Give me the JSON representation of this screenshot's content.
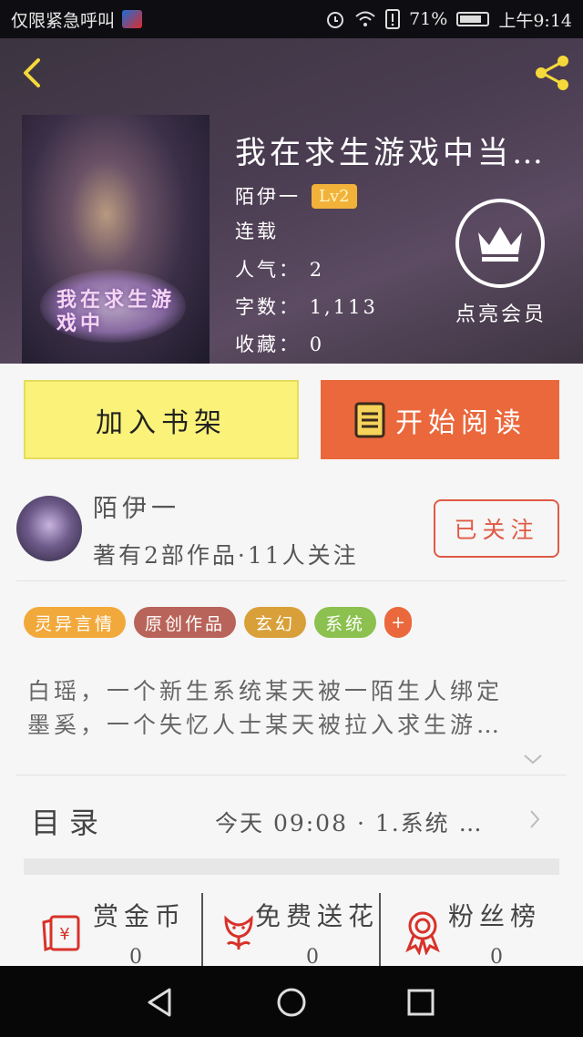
{
  "status_bar": {
    "carrier": "仅限紧急呼叫",
    "battery": "71%",
    "time": "上午9:14"
  },
  "book": {
    "title": "我在求生游戏中当…",
    "author": "陌伊一",
    "level": "Lv2",
    "status": "连载",
    "popularity_label": "人气：",
    "popularity": "2",
    "word_count_label": "字数：",
    "word_count": "1,113",
    "favorites_label": "收藏：",
    "favorites": "0",
    "cover_text": "我在求生游戏中"
  },
  "vip": {
    "label": "点亮会员"
  },
  "actions": {
    "add_to_shelf": "加入书架",
    "start_reading": "开始阅读"
  },
  "author_card": {
    "name": "陌伊一",
    "stats": "著有2部作品·11人关注",
    "follow_label": "已关注"
  },
  "tags": [
    {
      "label": "灵异言情",
      "color": "#f2a93b"
    },
    {
      "label": "原创作品",
      "color": "#b9645a"
    },
    {
      "label": "玄幻",
      "color": "#d9a03a"
    },
    {
      "label": "系统",
      "color": "#8cc04f"
    },
    {
      "label": "+",
      "color": "#ea683c"
    }
  ],
  "synopsis": {
    "line1": "白瑶，一个新生系统某天被一陌生人绑定",
    "line2": "墨奚，一个失忆人士某天被拉入求生游…"
  },
  "catalog": {
    "label": "目录",
    "latest": "今天 09:08 · 1.系统 …"
  },
  "stats": [
    {
      "label": "赏金币",
      "value": "0",
      "icon": "red-envelope-icon"
    },
    {
      "label": "免费送花",
      "value": "0",
      "icon": "flower-icon"
    },
    {
      "label": "粉丝榜",
      "value": "0",
      "icon": "medal-icon"
    }
  ],
  "colors": {
    "accent_orange": "#ea683c",
    "shelf_yellow": "#fbf27a",
    "follow_red": "#e05a45",
    "level_badge": "#f2b23a",
    "back_icon": "#f5d93a"
  }
}
